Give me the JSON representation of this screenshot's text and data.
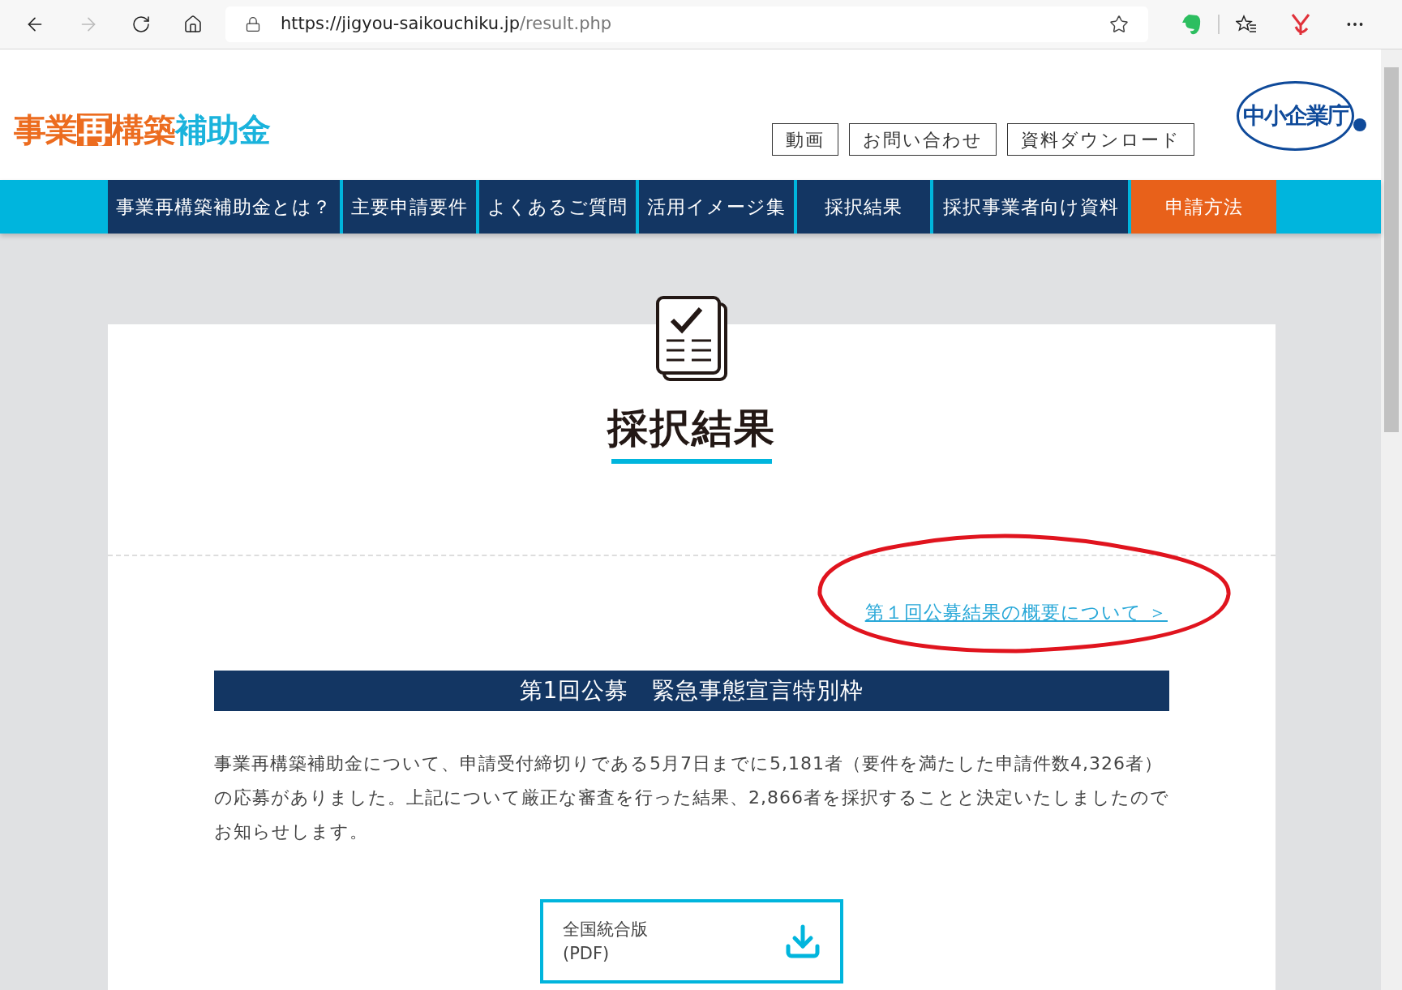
{
  "browser": {
    "url_host": "https://jigyou-saikouchiku.jp",
    "url_path": "/result.php"
  },
  "header": {
    "logo_parts": [
      {
        "text": "事業",
        "kind": "orange"
      },
      {
        "text": "再",
        "kind": "boxed"
      },
      {
        "text": "構築",
        "kind": "orange"
      },
      {
        "text": "補助金",
        "kind": "cyan"
      }
    ],
    "buttons": [
      "動画",
      "お問い合わせ",
      "資料ダウンロード"
    ],
    "agency_logo": "中小企業庁"
  },
  "nav": [
    {
      "label": "事業再構築補助金とは？",
      "kind": "normal"
    },
    {
      "label": "主要申請要件",
      "kind": "normal"
    },
    {
      "label": "よくあるご質問",
      "kind": "normal"
    },
    {
      "label": "活用イメージ集",
      "kind": "normal"
    },
    {
      "label": "採択結果",
      "kind": "normal"
    },
    {
      "label": "採択事業者向け資料",
      "kind": "normal"
    },
    {
      "label": "申請方法",
      "kind": "accent"
    }
  ],
  "page": {
    "title": "採択結果",
    "summary_link": "第１回公募結果の概要について ＞",
    "section_title": "第1回公募　緊急事態宣言特別枠",
    "paragraph": "事業再構築補助金について、申請受付締切りである5月7日までに5,181者（要件を満たした申請件数4,326者）の応募がありました。上記について厳正な審査を行った結果、2,866者を採択することと決定いたしましたのでお知らせします。",
    "download": {
      "label": "全国統合版",
      "format": "(PDF)"
    }
  }
}
